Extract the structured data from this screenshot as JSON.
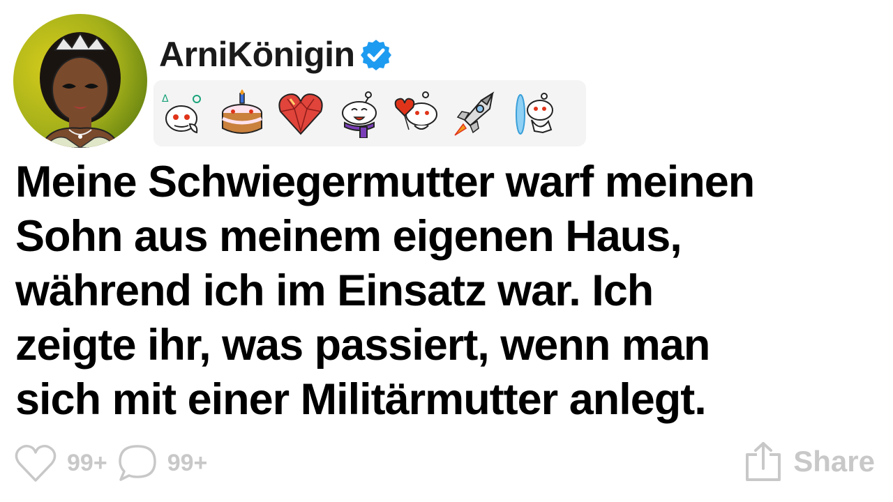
{
  "post": {
    "username": "ArniKönigin",
    "verified": true,
    "title": "Meine Schwiegermutter warf meinen\nSohn aus meinem eigenen Haus,\nwährend ich im Einsatz war. Ich\nzeigte ihr, was passiert, wenn man\nsich mit einer Militärmutter anlegt.",
    "badges": [
      {
        "icon": "snoo-thinking-icon"
      },
      {
        "icon": "birthday-cake-icon"
      },
      {
        "icon": "ruby-heart-icon"
      },
      {
        "icon": "snoo-scarf-icon"
      },
      {
        "icon": "snoo-heart-balloon-icon"
      },
      {
        "icon": "rocket-icon"
      },
      {
        "icon": "snoo-portal-icon"
      }
    ]
  },
  "actions": {
    "likes": "99+",
    "comments": "99+",
    "share_label": "Share"
  },
  "colors": {
    "verified": "#1d9bf0",
    "muted": "#c8c8c8",
    "avatar_bg_start": "#c9c21a",
    "avatar_bg_end": "#6f8c10"
  }
}
